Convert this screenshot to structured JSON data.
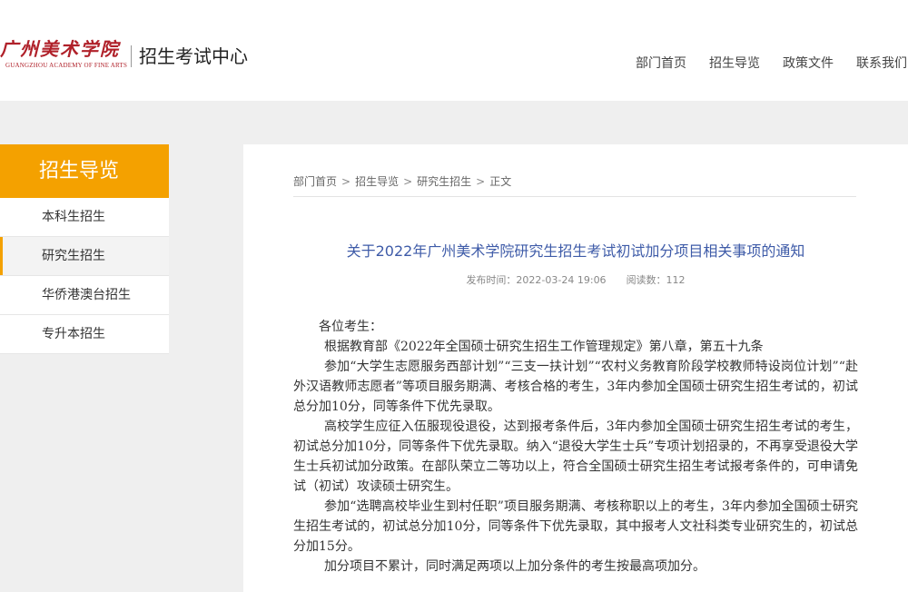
{
  "header": {
    "logo_text": "广州美术学院",
    "logo_en": "GUANGZHOU ACADEMY OF FINE ARTS",
    "site_name": "招生考试中心",
    "nav": [
      "部门首页",
      "招生导览",
      "政策文件",
      "联系我们"
    ]
  },
  "sidebar": {
    "title": "招生导览",
    "items": [
      "本科生招生",
      "研究生招生",
      "华侨港澳台招生",
      "专升本招生"
    ],
    "active_index": 1
  },
  "breadcrumb": {
    "items": [
      "部门首页",
      "招生导览",
      "研究生招生",
      "正文"
    ],
    "separator": ">"
  },
  "article": {
    "title": "关于2022年广州美术学院研究生招生考试初试加分项目相关事项的通知",
    "publish_time": "发布时间：2022-03-24 19:06",
    "views": "阅读数：112",
    "paragraphs": [
      "各位考生：",
      "根据教育部《2022年全国硕士研究生招生工作管理规定》第八章，第五十九条",
      "参加“大学生志愿服务西部计划”“三支一扶计划”“农村义务教育阶段学校教师特设岗位计划”“赴外汉语教师志愿者”等项目服务期满、考核合格的考生，3年内参加全国硕士研究生招生考试的，初试总分加10分，同等条件下优先录取。",
      "高校学生应征入伍服现役退役，达到报考条件后，3年内参加全国硕士研究生招生考试的考生，初试总分加10分，同等条件下优先录取。纳入“退役大学生士兵”专项计划招录的，不再享受退役大学生士兵初试加分政策。在部队荣立二等功以上，符合全国硕士研究生招生考试报考条件的，可申请免试（初试）攻读硕士研究生。",
      "参加“选聘高校毕业生到村任职”项目服务期满、考核称职以上的考生，3年内参加全国硕士研究生招生考试的，初试总分加10分，同等条件下优先录取，其中报考人文社科类专业研究生的，初试总分加15分。",
      "加分项目不累计，同时满足两项以上加分条件的考生按最高项加分。"
    ]
  },
  "colors": {
    "accent": "#f4a100",
    "title_blue": "#3e5ba8",
    "logo_red": "#b0212a"
  }
}
